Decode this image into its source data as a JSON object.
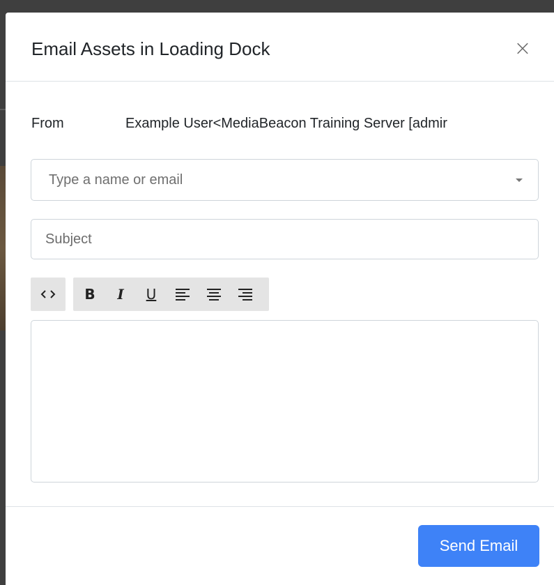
{
  "modal": {
    "title": "Email Assets in Loading Dock",
    "close_icon": "close-icon",
    "close_glyph": "×"
  },
  "from": {
    "label": "From",
    "value": "Example User<MediaBeacon Training Server [admir"
  },
  "recipients": {
    "placeholder": "Type a name or email",
    "caret_icon": "caret-down-icon"
  },
  "subject": {
    "placeholder": "Subject"
  },
  "toolbar": {
    "code_icon": "code-icon",
    "bold_label": "B",
    "italic_label": "I",
    "underline_label": "U",
    "align_left_icon": "align-left-icon",
    "align_center_icon": "align-center-icon",
    "align_right_icon": "align-right-icon"
  },
  "editor": {
    "value": ""
  },
  "footer": {
    "send_label": "Send Email"
  },
  "colors": {
    "primary": "#3e82f7",
    "border": "#ced4da",
    "toolbar_bg": "#e4e4e4",
    "title_text": "#212529",
    "placeholder_text": "#6c757d"
  }
}
